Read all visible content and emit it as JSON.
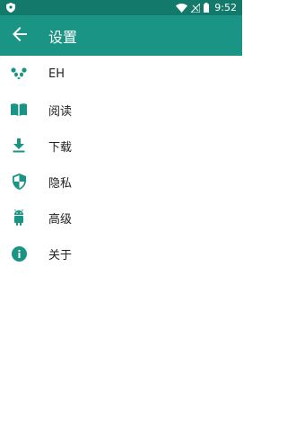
{
  "status_bar": {
    "time": "9:52",
    "icons": [
      "shield-notification-icon",
      "wifi-icon",
      "signal-icon",
      "battery-icon"
    ]
  },
  "app_bar": {
    "title": "设置",
    "back_icon": "arrow-back-icon",
    "background": "#1a9484",
    "status_background": "#137a6b"
  },
  "menu": {
    "icon_color": "#1a9484",
    "items": [
      {
        "label": "EH",
        "icon": "panda-icon"
      },
      {
        "label": "阅读",
        "icon": "book-icon"
      },
      {
        "label": "下载",
        "icon": "download-icon"
      },
      {
        "label": "隐私",
        "icon": "shield-icon"
      },
      {
        "label": "高级",
        "icon": "android-icon"
      },
      {
        "label": "关于",
        "icon": "info-icon"
      }
    ]
  }
}
